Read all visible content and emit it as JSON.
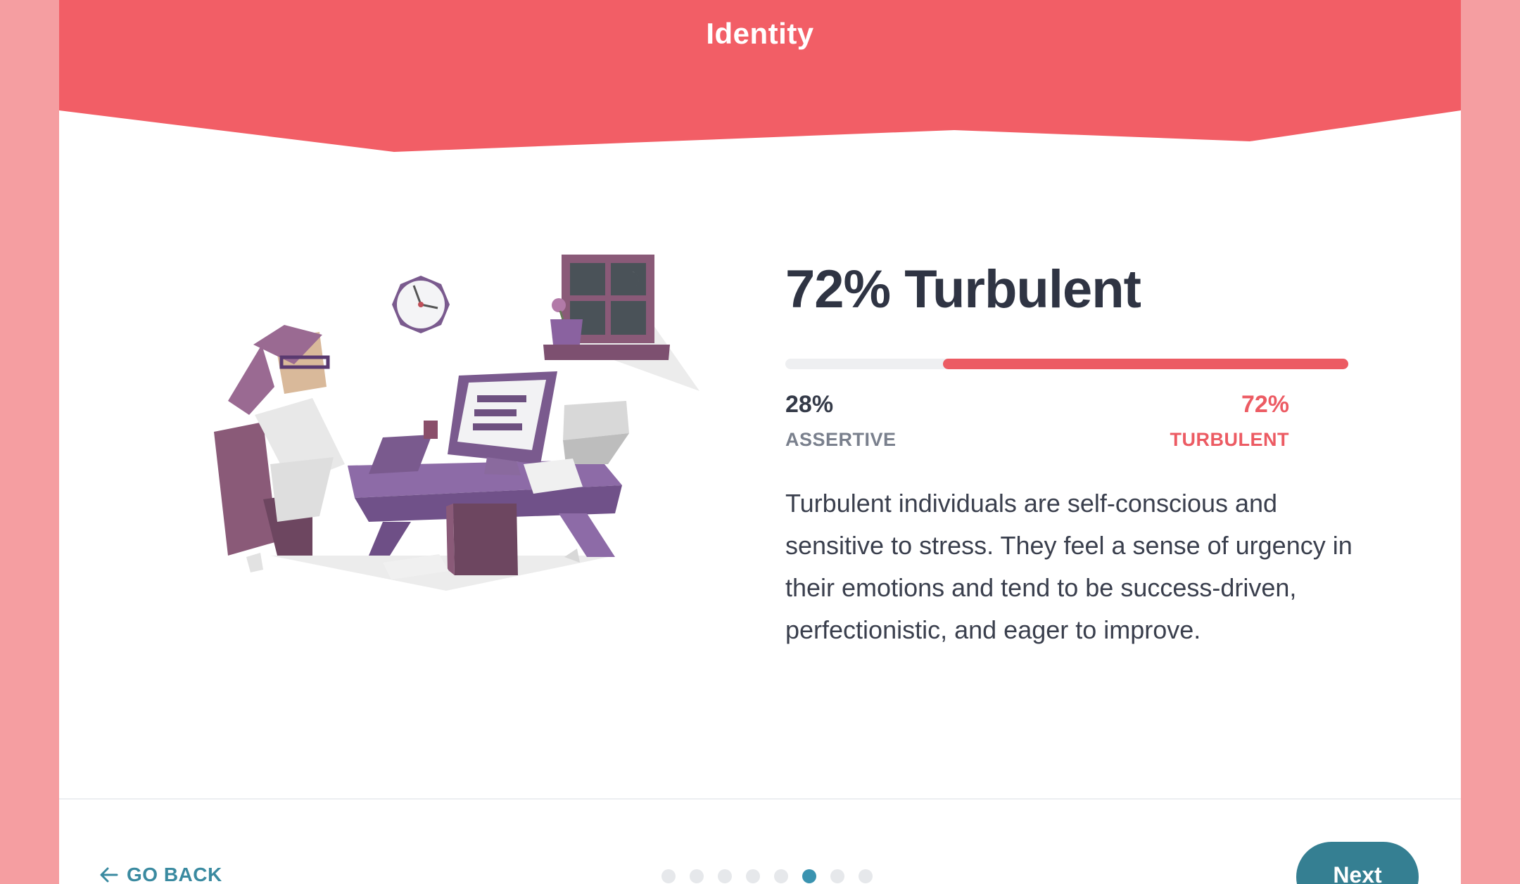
{
  "header": {
    "title": "Identity",
    "color": "#f25e66"
  },
  "result": {
    "heading": "72% Turbulent",
    "left_percent": "28%",
    "left_label": "ASSERTIVE",
    "right_percent": "72%",
    "right_label": "TURBULENT",
    "turbulent_fraction": 0.72,
    "description": "Turbulent individuals are self-conscious and sensitive to stress. They feel a sense of urgency in their emotions and tend to be success-driven, perfectionistic, and eager to improve."
  },
  "footer": {
    "go_back_label": "GO BACK",
    "next_label": "Next",
    "progress_dots_total": 8,
    "progress_dots_active": 6
  },
  "colors": {
    "accent": "#ec5b63",
    "teal": "#357f92",
    "text": "#2f3443"
  },
  "illustration": {
    "icon": "stressed-person-at-desk-illustration"
  }
}
